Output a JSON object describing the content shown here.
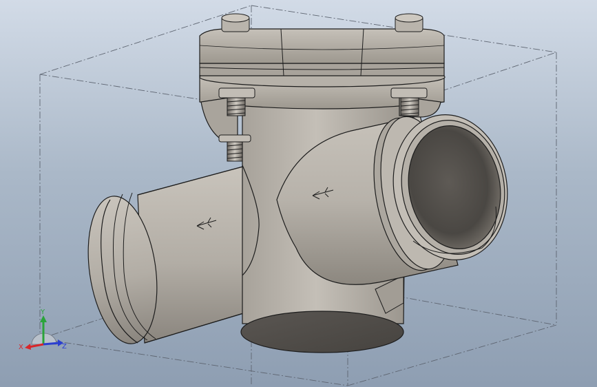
{
  "viewport": {
    "model": "tee-strainer-grooved-pipe-fitting",
    "background_top": "#d2dbe7",
    "background_bottom": "#8e9eb2",
    "bounding_box_style": "dash-dot",
    "display_mode": "shaded-with-edges"
  },
  "model_color": "#b2aca4",
  "triad": {
    "x_label": "X",
    "y_label": "Y",
    "z_label": "Z",
    "x_color": "#d8262a",
    "y_color": "#2aa43a",
    "z_color": "#2a3ed0"
  },
  "flow_arrows": [
    "arrow-icon",
    "arrow-icon"
  ]
}
